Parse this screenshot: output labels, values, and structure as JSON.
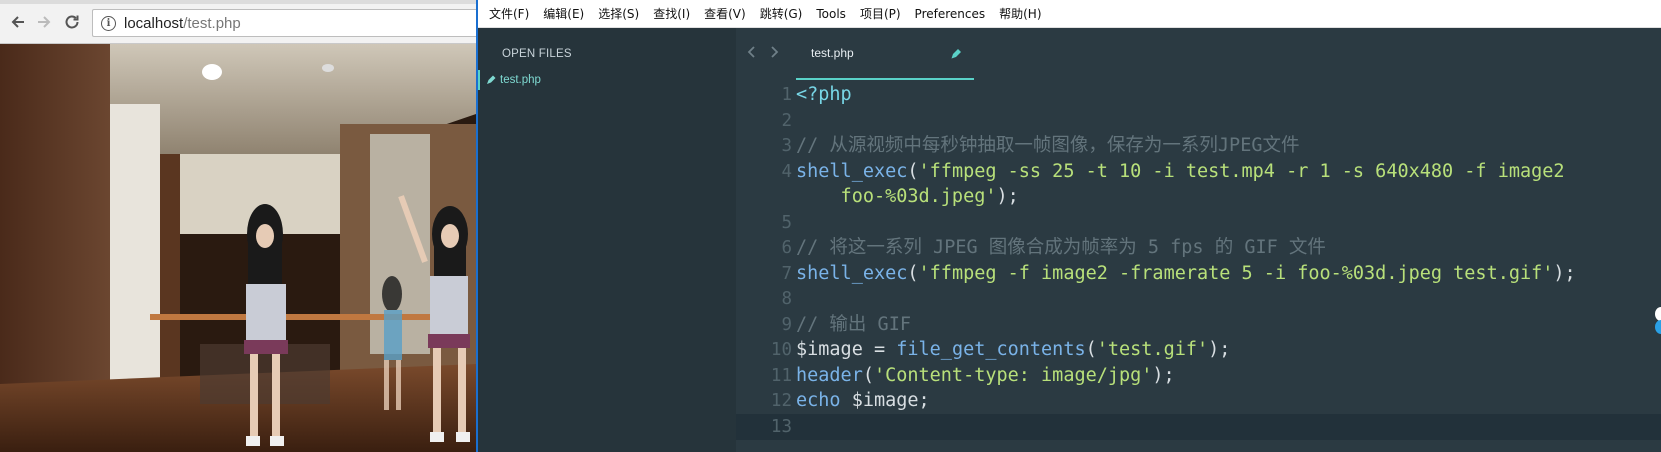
{
  "browser": {
    "url_host": "localhost",
    "url_path": "/test.php",
    "back_icon": "arrow-left-icon",
    "forward_icon": "arrow-right-icon",
    "reload_icon": "reload-icon",
    "info_icon": "info-icon"
  },
  "video": {
    "description_icon": "dance-video-gif"
  },
  "editor": {
    "menu": [
      "文件(F)",
      "编辑(E)",
      "选择(S)",
      "查找(I)",
      "查看(V)",
      "跳转(G)",
      "Tools",
      "项目(P)",
      "Preferences",
      "帮助(H)"
    ],
    "sidebar": {
      "title": "OPEN FILES",
      "files": [
        "test.php"
      ]
    },
    "tab": {
      "label": "test.php"
    },
    "lines": [
      {
        "n": "1",
        "segments": [
          {
            "t": "<?php",
            "c": "c-tag"
          }
        ]
      },
      {
        "n": "2",
        "segments": []
      },
      {
        "n": "3",
        "segments": [
          {
            "t": "// 从源视频中每秒钟抽取一帧图像，保存为一系列JPEG文件",
            "c": "c-comment"
          }
        ]
      },
      {
        "n": "4",
        "segments": [
          {
            "t": "shell_exec",
            "c": "c-fn"
          },
          {
            "t": "(",
            "c": "c-punct"
          },
          {
            "t": "'ffmpeg -ss 25 -t 10 -i test.mp4 -r 1 -s 640x480 -f image2",
            "c": "c-str"
          }
        ]
      },
      {
        "n": "",
        "segments": [
          {
            "t": "    foo-%03d.jpeg'",
            "c": "c-str"
          },
          {
            "t": ");",
            "c": "c-punct"
          }
        ]
      },
      {
        "n": "5",
        "segments": []
      },
      {
        "n": "6",
        "segments": [
          {
            "t": "// 将这一系列 JPEG 图像合成为帧率为 5 fps 的 GIF 文件",
            "c": "c-comment"
          }
        ]
      },
      {
        "n": "7",
        "segments": [
          {
            "t": "shell_exec",
            "c": "c-fn"
          },
          {
            "t": "(",
            "c": "c-punct"
          },
          {
            "t": "'ffmpeg -f image2 -framerate 5 -i foo-%03d.jpeg test.gif'",
            "c": "c-str"
          },
          {
            "t": ");",
            "c": "c-punct"
          }
        ]
      },
      {
        "n": "8",
        "segments": []
      },
      {
        "n": "9",
        "segments": [
          {
            "t": "// 输出 GIF",
            "c": "c-comment"
          }
        ]
      },
      {
        "n": "10",
        "segments": [
          {
            "t": "$image",
            "c": "c-var"
          },
          {
            "t": " = ",
            "c": "c-punct"
          },
          {
            "t": "file_get_contents",
            "c": "c-fn"
          },
          {
            "t": "(",
            "c": "c-punct"
          },
          {
            "t": "'test.gif'",
            "c": "c-str"
          },
          {
            "t": ");",
            "c": "c-punct"
          }
        ]
      },
      {
        "n": "11",
        "segments": [
          {
            "t": "header",
            "c": "c-fn"
          },
          {
            "t": "(",
            "c": "c-punct"
          },
          {
            "t": "'Content-type: image/jpg'",
            "c": "c-str"
          },
          {
            "t": ");",
            "c": "c-punct"
          }
        ]
      },
      {
        "n": "12",
        "segments": [
          {
            "t": "echo",
            "c": "c-fn"
          },
          {
            "t": " $image;",
            "c": "c-punct"
          }
        ]
      },
      {
        "n": "13",
        "segments": []
      }
    ],
    "current_line": "13",
    "colors": {
      "background": "#2b3a42",
      "accent": "#5ad2c8",
      "string": "#b8e07a",
      "function": "#7ab3e8",
      "comment": "#63747c"
    }
  }
}
